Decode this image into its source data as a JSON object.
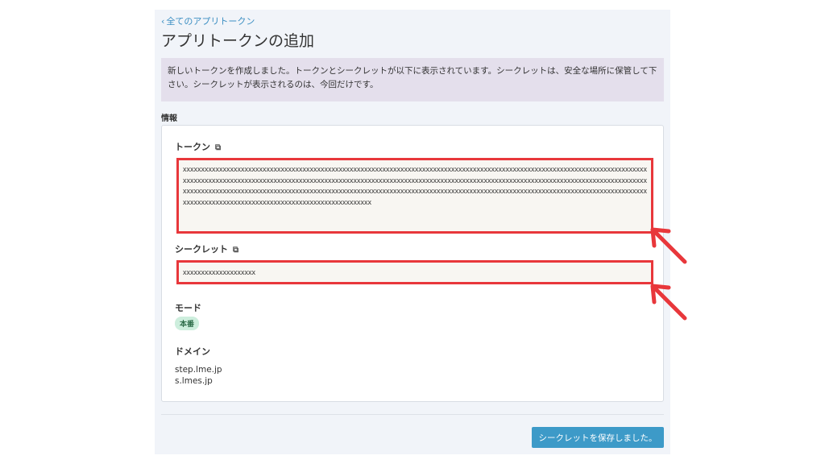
{
  "header": {
    "back_link": "全てのアプリトークン",
    "title": "アプリトークンの追加"
  },
  "notice": {
    "line1": "新しいトークンを作成しました。トークンとシークレットが以下に表示されています。シークレットは、安全な場所に保管して下",
    "line2": "さい。シークレットが表示されるのは、今回だけです。"
  },
  "info": {
    "section_label": "情報",
    "token_label": "トークン",
    "token_value": "xxxxxxxxxxxxxxxxxxxxxxxxxxxxxxxxxxxxxxxxxxxxxxxxxxxxxxxxxxxxxxxxxxxxxxxxxxxxxxxxxxxxxxxxxxxxxxxxxxxxxxxxxxxxxxxxxxxxxxxxxxxxxxxxxxxxxxxxxxxxxxxxxxxxxxxxxxxxxxxxxxxxxxxxxxxxxxxxxxxxxxxxxxxxxxxxxxxxxxxxxxxxxxxxxxxxxxxxxxxxxxxxxxxxxxxxxxxxxxxxxxxxxxxxxxxxxxxxxxxxxxxxxxxxxxxxxxxxxxxxxxxxxxxxxxxxxxxxxxxxxxxxxxxxxxxxxxxxxxxxxxxxxxxxxxxxxxxxxxxxxxxxxxxxxxxxxxxxxxxxxxxxxxxxxxxxxxxxxxxxxxxxxxxxxxxxxxxxxxxxxxxxxxxxxxxxxxxxxxxxxxxxxxxxxxxxxxxx",
    "secret_label": "シークレット",
    "secret_value": "xxxxxxxxxxxxxxxxxxxx",
    "mode_label": "モード",
    "mode_value": "本番",
    "domain_label": "ドメイン",
    "domains": [
      "step.lme.jp",
      "s.lmes.jp"
    ]
  },
  "footer": {
    "save_button": "シークレットを保存しました。"
  },
  "colors": {
    "accent": "#3d9ac8",
    "highlight": "#e8373b",
    "notice_bg": "#e4dfec",
    "badge_bg": "#cdeedd"
  },
  "icons": {
    "back": "chevron-left-icon",
    "copy": "copy-icon",
    "annotation": "arrow-icon"
  }
}
